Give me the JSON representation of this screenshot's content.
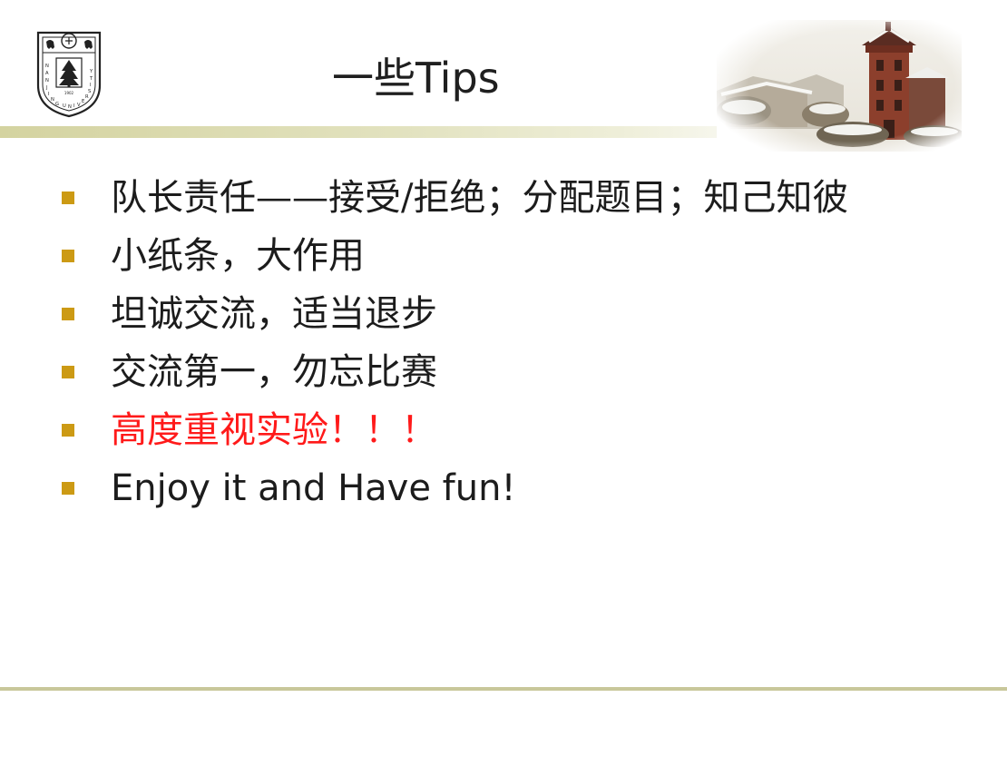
{
  "slide": {
    "title": "一些Tips",
    "logo": {
      "icon": "nanjing-university-seal-icon",
      "text": "NANJING UNIVERSITY",
      "year": "1902"
    },
    "bullets": [
      {
        "text": "队长责任——接受/拒绝；分配题目；知己知彼",
        "style": "normal"
      },
      {
        "text": "小纸条，大作用",
        "style": "normal"
      },
      {
        "text": "坦诚交流，适当退步",
        "style": "normal"
      },
      {
        "text": "交流第一，勿忘比赛",
        "style": "normal"
      },
      {
        "text": "高度重视实验！！！",
        "style": "emphasis"
      },
      {
        "text": "Enjoy it and Have fun!",
        "style": "latin"
      }
    ]
  },
  "colors": {
    "bullet_marker": "#cc9a14",
    "emphasis_text": "#ff1a1a",
    "header_bar": "#d4d3a0",
    "footer_line": "#c8c79a"
  }
}
